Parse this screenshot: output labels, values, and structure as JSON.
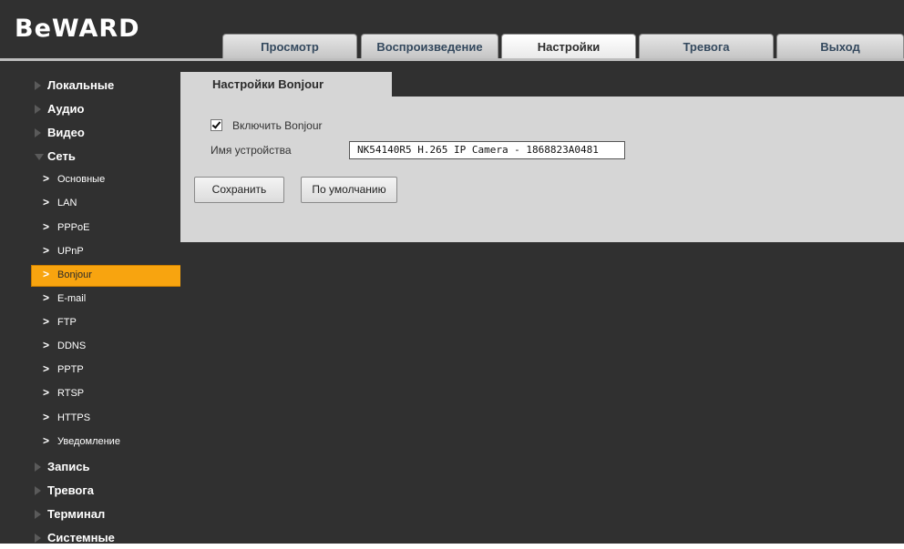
{
  "logo": {
    "text": "BeWARD"
  },
  "nav": {
    "tabs": [
      {
        "label": "Просмотр",
        "active": false
      },
      {
        "label": "Воспроизведение",
        "active": false
      },
      {
        "label": "Настройки",
        "active": true
      },
      {
        "label": "Тревога",
        "active": false
      },
      {
        "label": "Выход",
        "active": false
      }
    ]
  },
  "sidebar": {
    "categories_top": [
      {
        "label": "Локальные"
      },
      {
        "label": "Аудио"
      },
      {
        "label": "Видео"
      },
      {
        "label": "Сеть",
        "expanded": true
      }
    ],
    "network_items": [
      {
        "label": "Основные"
      },
      {
        "label": "LAN"
      },
      {
        "label": "PPPoE"
      },
      {
        "label": "UPnP"
      },
      {
        "label": "Bonjour",
        "active": true
      },
      {
        "label": "E-mail"
      },
      {
        "label": "FTP"
      },
      {
        "label": "DDNS"
      },
      {
        "label": "PPTP"
      },
      {
        "label": "RTSP"
      },
      {
        "label": "HTTPS"
      },
      {
        "label": "Уведомление"
      }
    ],
    "categories_bottom": [
      {
        "label": "Запись"
      },
      {
        "label": "Тревога"
      },
      {
        "label": "Терминал"
      },
      {
        "label": "Системные"
      }
    ]
  },
  "content": {
    "tab_title": "Настройки Bonjour",
    "enable_checkbox": {
      "label": "Включить Bonjour",
      "checked": true
    },
    "device_name": {
      "label": "Имя устройства",
      "value": "NK54140R5 H.265 IP Camera - 1868823A0481"
    },
    "save_label": "Сохранить",
    "default_label": "По умолчанию"
  },
  "colors": {
    "background": "#303030",
    "panel": "#d6d6d6",
    "active_item": "#f8a40f",
    "tab_text": "#34495e"
  }
}
